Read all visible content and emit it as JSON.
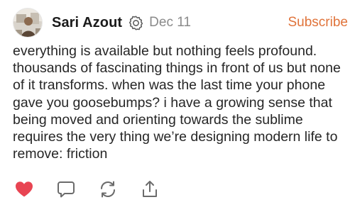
{
  "post": {
    "author": "Sari Azout",
    "date": "Dec 11",
    "subscribe_label": "Subscribe",
    "body": "everything is available but nothing feels profound. thousands of fascinating things in front of us but none of it transforms. when was the last time your phone gave you goosebumps? i have a growing sense that being moved and orienting towards the sublime requires the very thing we’re designing modern life to remove: friction"
  },
  "actions": {
    "like": {
      "icon": "heart-icon",
      "liked": true,
      "color": "#e84452"
    },
    "comment": {
      "icon": "comment-icon"
    },
    "restack": {
      "icon": "restack-icon"
    },
    "share": {
      "icon": "share-icon"
    }
  },
  "colors": {
    "accent": "#e0733a",
    "text": "#262626",
    "muted": "#8a8a8a",
    "icon": "#6b6b6b"
  },
  "badge_icon": "verified-badge-icon",
  "avatar_icon": "avatar-photo"
}
